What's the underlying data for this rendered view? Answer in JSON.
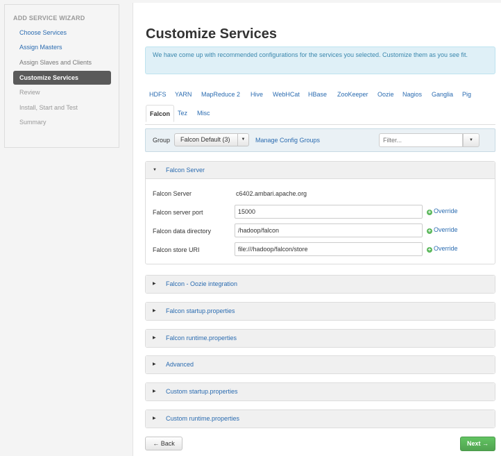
{
  "sidebar": {
    "title": "ADD SERVICE WIZARD",
    "steps": [
      {
        "label": "Choose Services"
      },
      {
        "label": "Assign Masters"
      },
      {
        "label": "Assign Slaves and Clients"
      },
      {
        "label": "Customize Services"
      },
      {
        "label": "Review"
      },
      {
        "label": "Install, Start and Test"
      },
      {
        "label": "Summary"
      }
    ]
  },
  "main": {
    "title": "Customize Services",
    "info": "We have come up with recommended configurations for the services you selected. Customize them as you see fit.",
    "tabs_row1": [
      "HDFS",
      "YARN",
      "MapReduce 2",
      "Hive",
      "WebHCat",
      "HBase",
      "ZooKeeper",
      "Oozie",
      "Nagios",
      "Ganglia",
      "Pig"
    ],
    "tabs_row2": [
      "Falcon",
      "Tez",
      "Misc"
    ],
    "active_tab": "Falcon",
    "group": {
      "label": "Group",
      "selected": "Falcon Default (3)",
      "manage_link": "Manage Config Groups",
      "filter_placeholder": "Filter..."
    },
    "expanded_section": {
      "title": "Falcon Server",
      "properties": [
        {
          "label": "Falcon Server",
          "value": "c6402.ambari.apache.org"
        },
        {
          "label": "Falcon server port",
          "value": "15000",
          "action": "Override"
        },
        {
          "label": "Falcon data directory",
          "value": "/hadoop/falcon",
          "action": "Override"
        },
        {
          "label": "Falcon store URI",
          "value": "file:///hadoop/falcon/store",
          "action": "Override"
        }
      ]
    },
    "collapsed_sections": [
      "Falcon - Oozie integration",
      "Falcon startup.properties",
      "Falcon runtime.properties",
      "Advanced",
      "Custom startup.properties",
      "Custom runtime.properties"
    ],
    "back_label": "← Back",
    "next_label": "Next →"
  },
  "colors": {
    "link": "#2a6bb0",
    "active_step_bg": "#5a5a5a",
    "info_bg": "#dff0f7",
    "next_button": "#5bb75b",
    "override_icon": "#5cb85c"
  }
}
